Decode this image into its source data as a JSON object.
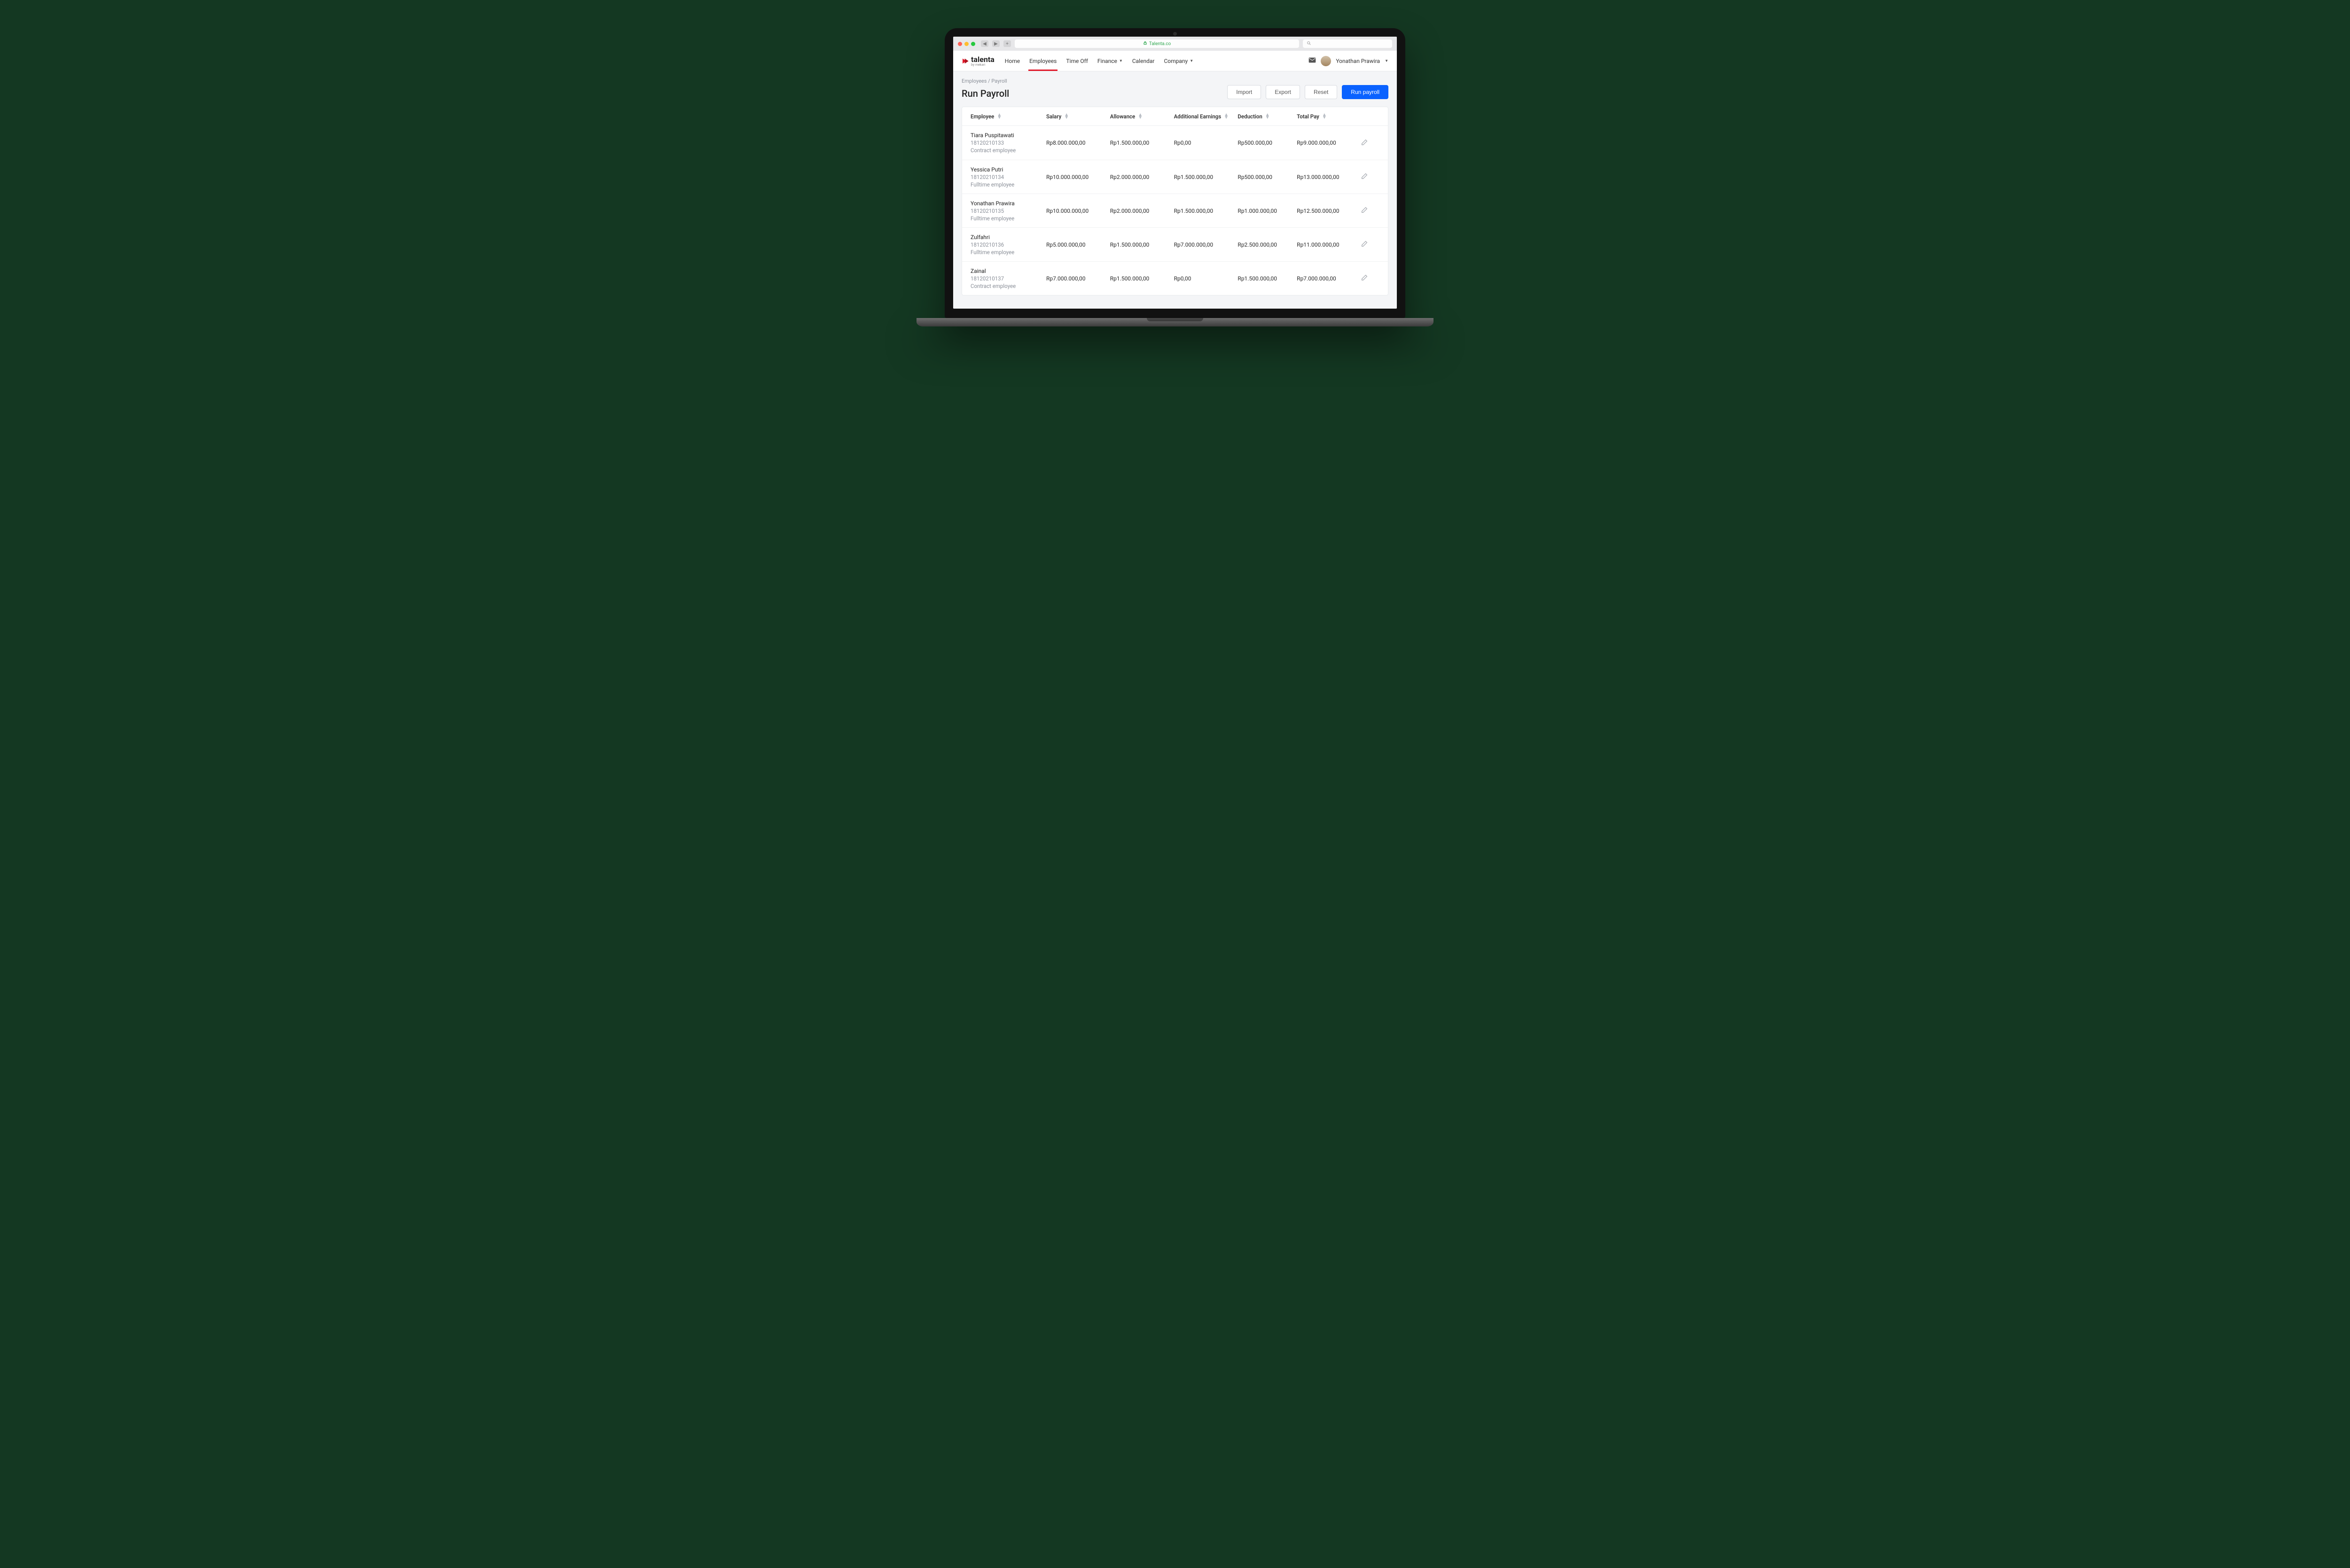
{
  "browser": {
    "url_host": "Talenta.co"
  },
  "brand": {
    "name": "talenta",
    "subtitle": "by mekari"
  },
  "nav": {
    "items": [
      {
        "label": "Home"
      },
      {
        "label": "Employees",
        "active": true
      },
      {
        "label": "Time Off"
      },
      {
        "label": "Finance",
        "dropdown": true
      },
      {
        "label": "Calendar"
      },
      {
        "label": "Company",
        "dropdown": true
      }
    ]
  },
  "user": {
    "display_name": "Yonathan Prawira"
  },
  "breadcrumb": "Employees / Payroll",
  "page_title": "Run Payroll",
  "buttons": {
    "import": "Import",
    "export": "Export",
    "reset": "Reset",
    "run": "Run payroll"
  },
  "columns": {
    "employee": "Employee",
    "salary": "Salary",
    "allowance": "Allowance",
    "additional": "Additional Earnings",
    "deduction": "Deduction",
    "total": "Total Pay"
  },
  "rows": [
    {
      "name": "Tiara Puspitawati",
      "id": "18120210133",
      "type": "Contract employee",
      "salary": "Rp8.000.000,00",
      "allowance": "Rp1.500.000,00",
      "additional": "Rp0,00",
      "deduction": "Rp500.000,00",
      "total": "Rp9.000.000,00"
    },
    {
      "name": "Yessica Putri",
      "id": "18120210134",
      "type": "Fulltime employee",
      "salary": "Rp10.000.000,00",
      "allowance": "Rp2.000.000,00",
      "additional": "Rp1.500.000,00",
      "deduction": "Rp500.000,00",
      "total": "Rp13.000.000,00"
    },
    {
      "name": "Yonathan Prawira",
      "id": "18120210135",
      "type": "Fulltime employee",
      "salary": "Rp10.000.000,00",
      "allowance": "Rp2.000.000,00",
      "additional": "Rp1.500.000,00",
      "deduction": "Rp1.000.000,00",
      "total": "Rp12.500.000,00"
    },
    {
      "name": "Zulfahri",
      "id": "18120210136",
      "type": "Fulltime employee",
      "salary": "Rp5.000.000,00",
      "allowance": "Rp1.500.000,00",
      "additional": "Rp7.000.000,00",
      "deduction": "Rp2.500.000,00",
      "total": "Rp11.000.000,00"
    },
    {
      "name": "Zainal",
      "id": "18120210137",
      "type": "Contract employee",
      "salary": "Rp7.000.000,00",
      "allowance": "Rp1.500.000,00",
      "additional": "Rp0,00",
      "deduction": "Rp1.500.000,00",
      "total": "Rp7.000.000,00"
    }
  ]
}
